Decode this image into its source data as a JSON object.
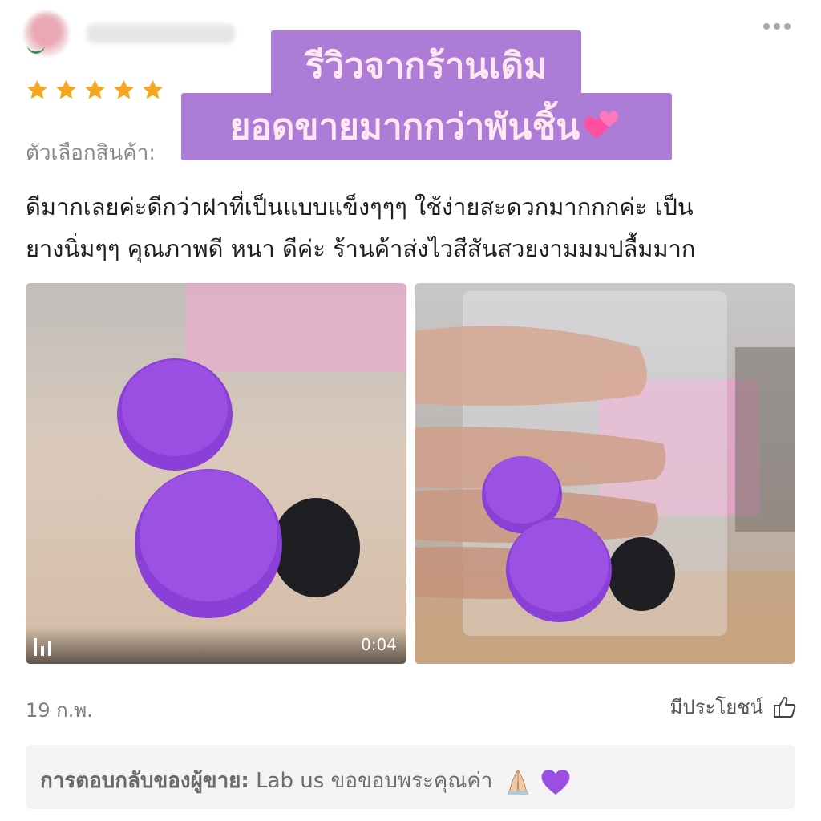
{
  "review": {
    "rating": 5,
    "variant_label": "ตัวเลือกสินค้า:",
    "text_line1": "ดีมากเลยค่ะดีกว่าฝาที่เป็นแบบแข็งๆๆๆ  ใช้ง่ายสะดวกมากกกค่ะ เป็น",
    "text_line2": "ยางนิ่มๆๆ คุณภาพดี หนา ดีค่ะ ร้านค้าส่งไวสีสันสวยงามมมปลื้มมาก",
    "date": "19 ก.พ.",
    "helpful_label": "มีประโยชน์"
  },
  "banner": {
    "line1": "รีวิวจากร้านเดิม",
    "line2": "ยอดขายมากกว่าพันชิ้น"
  },
  "media": {
    "video_duration": "0:04"
  },
  "seller_reply": {
    "label": "การตอบกลับของผู้ขาย:",
    "text": "Lab us ขอขอบพระคุณค่า"
  },
  "colors": {
    "banner_bg": "#ac7cd6",
    "star": "#f5a623",
    "cap_purple": "#8a3fd6",
    "cap_black": "#1d1d22"
  },
  "icons": [
    "more-icon",
    "star-icon",
    "heart-icon",
    "video-bars-icon",
    "thumbs-up-icon",
    "praying-hands-icon",
    "purple-heart-icon"
  ]
}
